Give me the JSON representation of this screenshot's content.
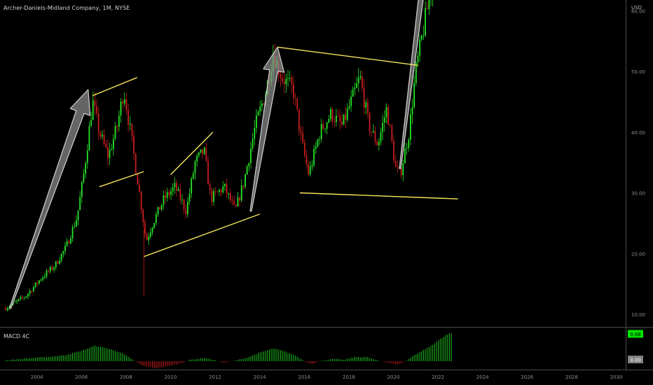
{
  "header": {
    "title": "Archer-Daniels-Midland Company, 1M, NYSE",
    "currency": "USD"
  },
  "price_badge": {
    "symbol": "ADM",
    "price": "86.35",
    "countdown": "13d 10h",
    "color": "#f23645"
  },
  "macd": {
    "title": "MACD 4C",
    "value_top": "9.88",
    "value_zero": "0.00",
    "value_top_color": "#00e600",
    "value_zero_color": "#808080"
  },
  "colors": {
    "up": "#26e626",
    "down": "#c81e1e",
    "trend_line": "#f5e35a",
    "arrow_fill": "#8c8c8c"
  },
  "chart_data": [
    {
      "type": "candlestick",
      "title": "Archer-Daniels-Midland Company, 1M, NYSE",
      "xlabel": "",
      "ylabel": "USD",
      "x_ticks": [
        "2004",
        "2006",
        "2008",
        "2010",
        "2012",
        "2014",
        "2016",
        "2018",
        "2020",
        "2022",
        "2024",
        "2026",
        "2028",
        "2030"
      ],
      "y_ticks": [
        "100.00",
        "90.00",
        "80.00",
        "70.00",
        "60.00",
        "50.00",
        "40.00",
        "30.00",
        "20.00",
        "10.00"
      ],
      "ylim": [
        6,
        103
      ],
      "xlim": [
        2002.5,
        2031.3
      ],
      "close_path": [
        [
          2002.6,
          11
        ],
        [
          2003.5,
          13
        ],
        [
          2004.2,
          16
        ],
        [
          2004.8,
          18
        ],
        [
          2005.3,
          21
        ],
        [
          2005.8,
          26
        ],
        [
          2006.1,
          33
        ],
        [
          2006.5,
          45
        ],
        [
          2006.8,
          40
        ],
        [
          2007.2,
          36
        ],
        [
          2007.6,
          41
        ],
        [
          2007.9,
          47
        ],
        [
          2008.2,
          40
        ],
        [
          2008.6,
          30
        ],
        [
          2008.9,
          22
        ],
        [
          2009.2,
          25
        ],
        [
          2009.7,
          29
        ],
        [
          2010.2,
          31
        ],
        [
          2010.7,
          27
        ],
        [
          2011.1,
          35
        ],
        [
          2011.5,
          37
        ],
        [
          2011.8,
          29
        ],
        [
          2012.4,
          31
        ],
        [
          2012.9,
          27
        ],
        [
          2013.3,
          32
        ],
        [
          2013.8,
          41
        ],
        [
          2014.3,
          47
        ],
        [
          2014.6,
          53
        ],
        [
          2015.0,
          49
        ],
        [
          2015.5,
          47
        ],
        [
          2015.9,
          38
        ],
        [
          2016.2,
          33
        ],
        [
          2016.7,
          40
        ],
        [
          2017.2,
          43
        ],
        [
          2017.7,
          41
        ],
        [
          2018.2,
          46
        ],
        [
          2018.5,
          49
        ],
        [
          2018.9,
          41
        ],
        [
          2019.3,
          38
        ],
        [
          2019.7,
          44
        ],
        [
          2020.1,
          34
        ],
        [
          2020.3,
          33
        ],
        [
          2020.7,
          40
        ],
        [
          2021.0,
          50
        ],
        [
          2021.4,
          58
        ],
        [
          2021.8,
          66
        ],
        [
          2022.1,
          78
        ],
        [
          2022.3,
          90
        ],
        [
          2022.6,
          78
        ],
        [
          2022.9,
          84
        ],
        [
          2023.3,
          80
        ],
        [
          2023.6,
          72
        ],
        [
          2023.9,
          76
        ],
        [
          2024.3,
          83
        ],
        [
          2024.8,
          79
        ],
        [
          2025.3,
          77
        ],
        [
          2025.9,
          84
        ],
        [
          2026.3,
          86
        ],
        [
          2026.7,
          78
        ],
        [
          2027.2,
          80
        ],
        [
          2027.6,
          75
        ],
        [
          2027.9,
          80
        ],
        [
          2028.0,
          68
        ],
        [
          2028.2,
          76
        ]
      ],
      "trend_lines": [
        {
          "from": [
            2006.5,
            46
          ],
          "to": [
            2008.5,
            49
          ]
        },
        {
          "from": [
            2006.8,
            31
          ],
          "to": [
            2008.8,
            33.5
          ]
        },
        {
          "from": [
            2008.8,
            19.5
          ],
          "to": [
            2014.0,
            26.5
          ]
        },
        {
          "from": [
            2010.0,
            33
          ],
          "to": [
            2011.9,
            40
          ]
        },
        {
          "from": [
            2014.8,
            54
          ],
          "to": [
            2021.1,
            51
          ]
        },
        {
          "from": [
            2015.8,
            30
          ],
          "to": [
            2022.9,
            29
          ]
        },
        {
          "from": [
            2022.5,
            93.5
          ],
          "to": [
            2030.6,
            82
          ]
        },
        {
          "from": [
            2022.9,
            70.5
          ],
          "to": [
            2028.6,
            63.5
          ]
        }
      ],
      "arrows": [
        {
          "from": [
            2002.8,
            11
          ],
          "to": [
            2006.3,
            47
          ]
        },
        {
          "from": [
            2013.6,
            27
          ],
          "to": [
            2014.8,
            54
          ]
        },
        {
          "from": [
            2020.3,
            34
          ],
          "to": [
            2022.3,
            94
          ]
        }
      ],
      "last_price": 86.35
    },
    {
      "type": "histogram",
      "title": "MACD 4C",
      "labels": [
        "9.88",
        "0.00"
      ],
      "ylim": [
        -3.5,
        10
      ],
      "bar_path": [
        [
          2002.6,
          0.3
        ],
        [
          2003.5,
          1.0
        ],
        [
          2004.5,
          1.5
        ],
        [
          2005.3,
          2.2
        ],
        [
          2006.0,
          3.7
        ],
        [
          2006.6,
          5.5
        ],
        [
          2007.2,
          4.5
        ],
        [
          2007.8,
          3.0
        ],
        [
          2008.3,
          0.5
        ],
        [
          2008.7,
          -1.5
        ],
        [
          2009.3,
          -2.5
        ],
        [
          2009.9,
          -1.8
        ],
        [
          2010.4,
          -0.8
        ],
        [
          2010.9,
          0.5
        ],
        [
          2011.5,
          1.2
        ],
        [
          2012.0,
          0.3
        ],
        [
          2012.4,
          -0.6
        ],
        [
          2012.9,
          0.2
        ],
        [
          2013.4,
          1.2
        ],
        [
          2014.0,
          3.0
        ],
        [
          2014.6,
          4.5
        ],
        [
          2015.1,
          3.5
        ],
        [
          2015.6,
          2.0
        ],
        [
          2016.0,
          0.0
        ],
        [
          2016.3,
          -1.0
        ],
        [
          2016.8,
          0.2
        ],
        [
          2017.3,
          0.8
        ],
        [
          2017.8,
          0.5
        ],
        [
          2018.3,
          1.5
        ],
        [
          2018.8,
          1.5
        ],
        [
          2019.3,
          0.2
        ],
        [
          2019.8,
          -0.5
        ],
        [
          2020.2,
          -1.3
        ],
        [
          2020.6,
          0.3
        ],
        [
          2021.0,
          2.5
        ],
        [
          2021.4,
          4.2
        ],
        [
          2021.8,
          6.0
        ],
        [
          2022.1,
          8.0
        ],
        [
          2022.5,
          9.9
        ]
      ],
      "bar_end": 2022.6
    }
  ]
}
